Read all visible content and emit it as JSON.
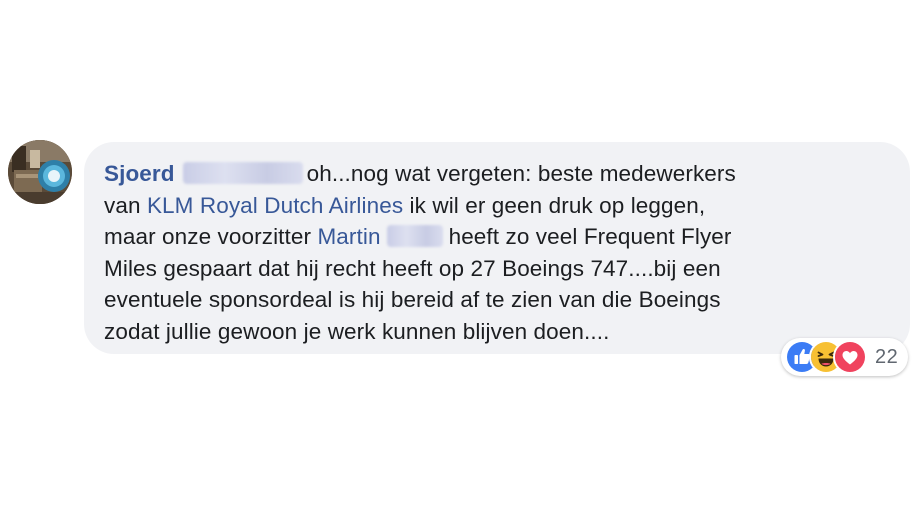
{
  "comment": {
    "author": "Sjoerd",
    "lines": [
      "oh...nog wat vergeten: beste medewerkers",
      "van",
      "KLM Royal Dutch Airlines",
      "ik wil er geen druk op leggen,",
      "maar onze voorzitter",
      "Martin",
      "heeft zo veel Frequent Flyer",
      "Miles gespaart dat hij recht heeft op 27 Boeings 747....bij een",
      "eventuele sponsordeal is hij bereid af te zien van die Boeings",
      "zodat jullie gewoon je werk kunnen blijven doen...."
    ]
  },
  "reactions": {
    "icons": [
      "like-icon",
      "haha-icon",
      "love-icon"
    ],
    "count": "22",
    "colors": {
      "like": "#3b7cf5",
      "haha": "#f7c033",
      "love": "#f0435e",
      "link": "#385898",
      "bubble": "#f1f2f5"
    }
  }
}
